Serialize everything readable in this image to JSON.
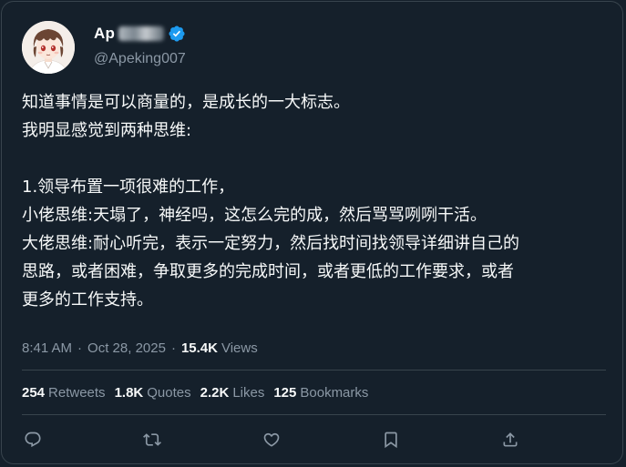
{
  "tweet": {
    "display_name": "Ap",
    "handle": "@Apeking007",
    "text_lines": [
      "知道事情是可以商量的，是成长的一大标志。",
      "我明显感觉到两种思维:",
      "",
      "1.领导布置一项很难的工作，",
      "小佬思维:天塌了，神经吗，这怎么完的成，然后骂骂咧咧干活。",
      "大佬思维:耐心听完，表示一定努力，然后找时间找领导详细讲自己的",
      "思路，或者困难，争取更多的完成时间，或者更低的工作要求，或者",
      "更多的工作支持。"
    ],
    "time": "8:41 AM",
    "date": "Oct 28, 2025",
    "views_count": "15.4K",
    "views_label": "Views",
    "separator": "·"
  },
  "stats": [
    {
      "count": "254",
      "label": "Retweets"
    },
    {
      "count": "1.8K",
      "label": "Quotes"
    },
    {
      "count": "2.2K",
      "label": "Likes"
    },
    {
      "count": "125",
      "label": "Bookmarks"
    }
  ],
  "actions": [
    "reply-icon",
    "retweet-icon",
    "like-icon",
    "bookmark-icon",
    "share-icon"
  ],
  "colors": {
    "background": "#15202b",
    "border": "#38444d",
    "secondary_text": "#8b98a5",
    "verified": "#1d9bf0"
  }
}
